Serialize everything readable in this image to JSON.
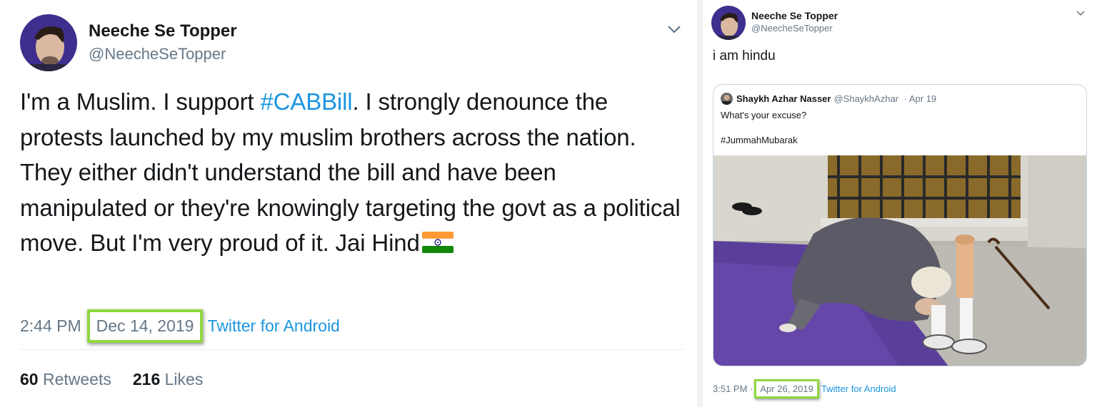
{
  "left_tweet": {
    "author_name": "Neeche Se Topper",
    "author_handle": "@NeecheSeTopper",
    "text_before": "I'm a Muslim. I support ",
    "hashtag": "#CABBill",
    "text_after": ". I strongly denounce the protests launched by my muslim brothers across the nation. They either didn't understand the bill and have been manipulated or they're knowingly targeting the govt as a political move. But I'm very proud of it. Jai Hind",
    "time": "2:44 PM",
    "date": "Dec 14, 2019",
    "source": "Twitter for Android",
    "retweets_count": "60",
    "retweets_label": "Retweets",
    "likes_count": "216",
    "likes_label": "Likes",
    "icons": [
      "avatar",
      "chevron-down-icon",
      "india-flag-emoji"
    ]
  },
  "right_tweet": {
    "author_name": "Neeche Se Topper",
    "author_handle": "@NeecheSeTopper",
    "text": "i am hindu",
    "quoted": {
      "author_name": "Shaykh Azhar Nasser",
      "author_handle": "@ShaykhAzhar",
      "date": "· Apr 19",
      "text": "What's your excuse?",
      "hashtag": "#JummahMubarak"
    },
    "time": "3:51 PM",
    "separator": "·",
    "date": "Apr 26, 2019",
    "source": "Twitter for Android",
    "icons": [
      "avatar",
      "chevron-down-icon"
    ]
  },
  "colors": {
    "link": "#1b95e0",
    "secondary_text": "#657786",
    "highlight_box": "#8fd840"
  }
}
